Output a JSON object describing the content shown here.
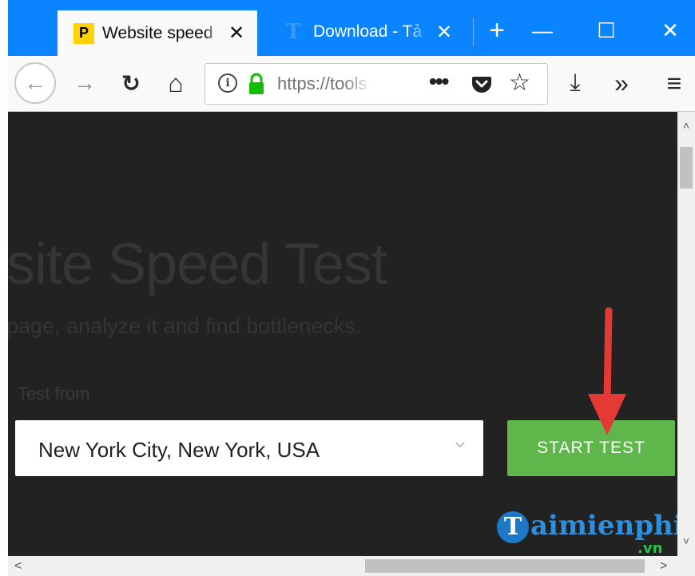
{
  "tabs": [
    {
      "favicon": "P",
      "title": "Website speed",
      "close": "✕"
    },
    {
      "favicon": "T",
      "title": "Download - Tả",
      "close": "✕"
    }
  ],
  "window": {
    "new_tab": "+",
    "minimize": "—",
    "maximize": "☐",
    "close": "✕"
  },
  "nav": {
    "back": "←",
    "forward": "→",
    "reload": "↻",
    "home": "⌂",
    "url": "https://tools",
    "page_actions": "•••",
    "star": "☆",
    "downloads": "⤓",
    "overflow": "»",
    "menu": "≡"
  },
  "page": {
    "title": "site Speed Test",
    "subtitle": "page, analyze it and find bottlenecks.",
    "test_from_label": "Test from",
    "location_value": "New York City, New York, USA",
    "start_button": "START TEST"
  },
  "watermark": {
    "letter": "T",
    "text": "aimienphi",
    "suffix": ".vn"
  },
  "scroll": {
    "up": "˄",
    "down": "˅",
    "left": "<",
    "right": ">"
  },
  "colors": {
    "accent": "#0a84ff",
    "start_button": "#5fb64a",
    "page_bg": "#222222",
    "arrow": "#e53935"
  }
}
